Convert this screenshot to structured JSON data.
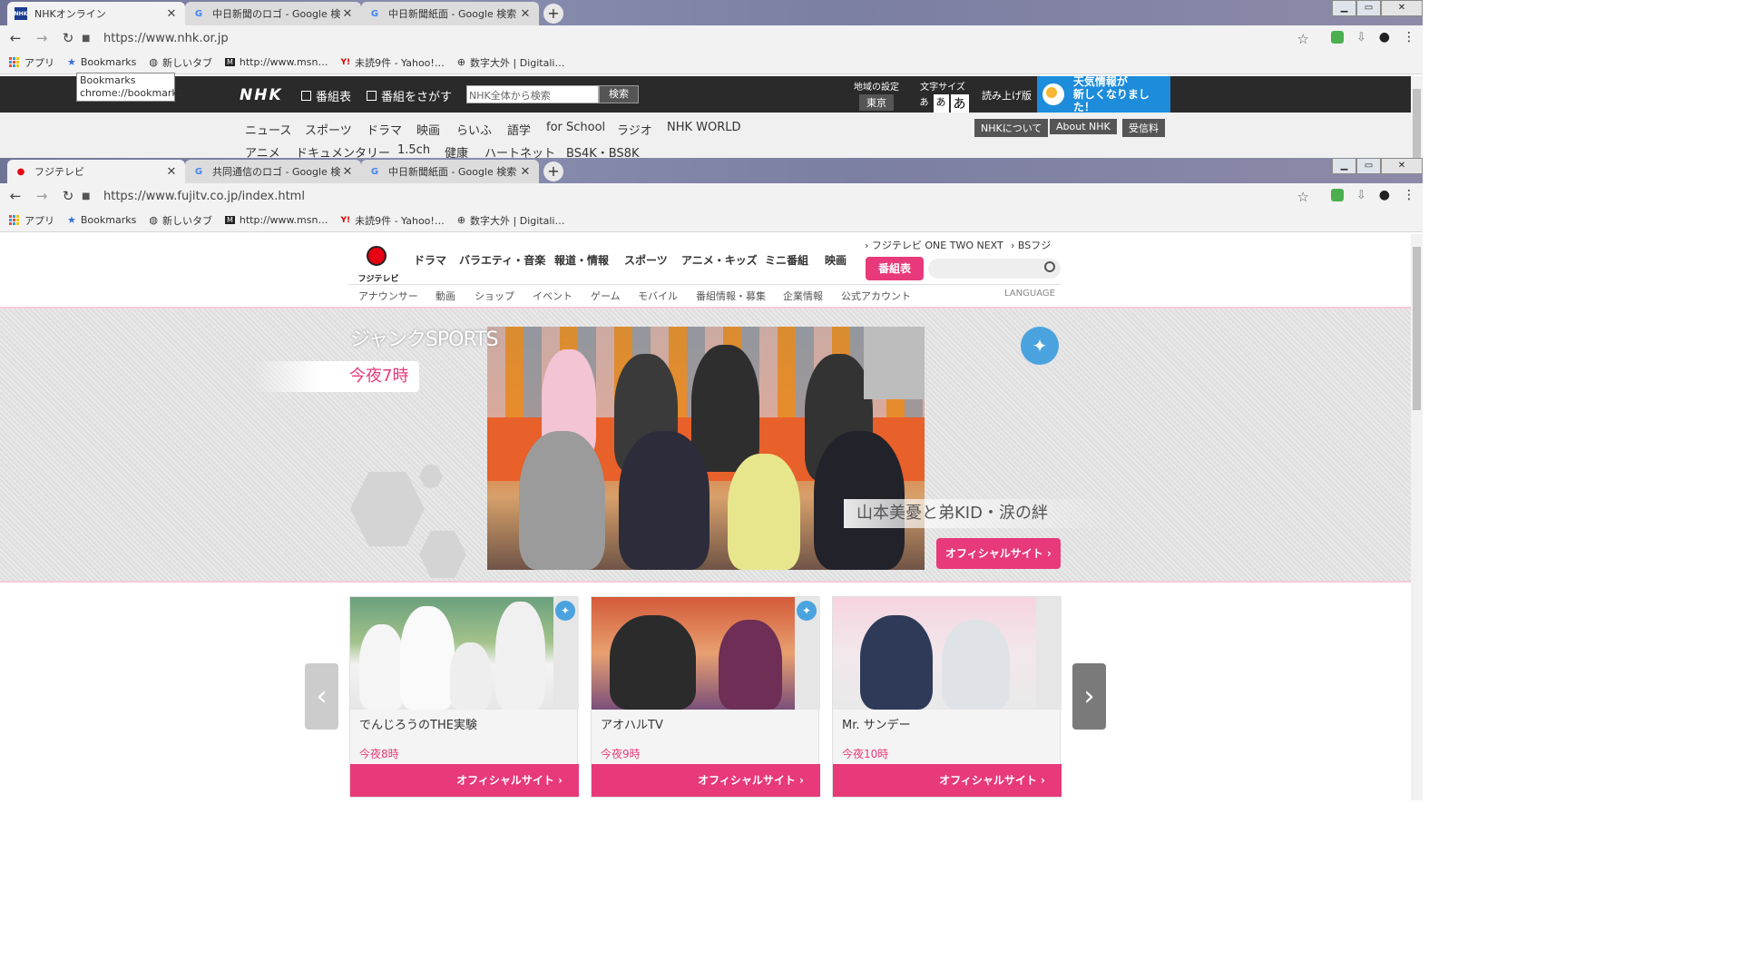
{
  "window1": {
    "tabs": [
      {
        "title": "NHKオンライン",
        "favicon": "nhk-favicon",
        "active": true
      },
      {
        "title": "中日新聞のロゴ - Google 検索",
        "favicon": "google-g",
        "active": false
      },
      {
        "title": "中日新聞紙面 - Google 検索",
        "favicon": "google-g",
        "active": false
      }
    ],
    "url": "https://www.nhk.or.jp",
    "tooltip_line1": "Bookmarks",
    "tooltip_line2": "chrome://bookmarks"
  },
  "window2": {
    "tabs": [
      {
        "title": "フジテレビ",
        "favicon": "fuji-favicon",
        "active": true
      },
      {
        "title": "共同通信のロゴ - Google 検索",
        "favicon": "google-g",
        "active": false
      },
      {
        "title": "中日新聞紙面 - Google 検索",
        "favicon": "google-g",
        "active": false
      }
    ],
    "url": "https://www.fujitv.co.jp/index.html"
  },
  "bookmarks": [
    {
      "label": "アプリ",
      "icon": "apps-grid-icon"
    },
    {
      "label": "Bookmarks",
      "icon": "star-icon"
    },
    {
      "label": "新しいタブ",
      "icon": "globe-icon"
    },
    {
      "label": "http://www.msn…",
      "icon": "msn-icon"
    },
    {
      "label": "未読9件 - Yahoo!…",
      "icon": "yahoo-icon"
    },
    {
      "label": "数字大外 | Digitali…",
      "icon": "site-icon"
    }
  ],
  "nhk": {
    "logo": "NHK",
    "schedule": "番組表",
    "find_programs": "番組をさがす",
    "search_placeholder": "NHK全体から検索",
    "search_button": "検索",
    "region_label": "地域の設定",
    "region_value": "東京",
    "font_size_label": "文字サイズ",
    "font_small": "あ",
    "font_medium": "あ",
    "font_large": "あ",
    "read_aloud": "読み上げ版",
    "weather_line1": "天気情報が",
    "weather_line2": "新しくなりました！",
    "nav_row1": [
      "ニュース",
      "スポーツ",
      "ドラマ",
      "映画",
      "らいふ",
      "語学",
      "for School",
      "ラジオ",
      "NHK WORLD"
    ],
    "nav_row2": [
      "アニメ",
      "ドキュメンタリー",
      "1.5ch",
      "健康",
      "ハートネット",
      "BS4K・BS8K"
    ],
    "tags": [
      "NHKについて",
      "About NHK",
      "受信料"
    ]
  },
  "fuji": {
    "logo_text": "フジテレビ",
    "menu": [
      "ドラマ",
      "バラエティ・音楽",
      "報道・情報",
      "スポーツ",
      "アニメ・キッズ",
      "ミニ番組",
      "映画"
    ],
    "top_links": [
      "フジテレビ ONE TWO NEXT",
      "BSフジ"
    ],
    "schedule_button": "番組表",
    "submenu": [
      "アナウンサー",
      "動画",
      "ショップ",
      "イベント",
      "ゲーム",
      "モバイル",
      "番組情報・募集",
      "企業情報",
      "公式アカウント"
    ],
    "language": "LANGUAGE",
    "hero": {
      "title": "ジャンクSPORTS",
      "time": "今夜7時",
      "caption": "山本美憂と弟KID・涙の絆",
      "official": "オフィシャルサイト"
    },
    "cards": [
      {
        "name": "でんじろうのTHE実験",
        "time": "今夜8時",
        "official": "オフィシャルサイト"
      },
      {
        "name": "アオハルTV",
        "time": "今夜9時",
        "official": "オフィシャルサイト"
      },
      {
        "name": "Mr. サンデー",
        "time": "今夜10時",
        "official": "オフィシャルサイト"
      }
    ]
  },
  "colors": {
    "accent_pink": "#e8397a",
    "nhk_bar": "#2a2a2a",
    "weather_blue": "#1d8cdb",
    "twitter_blue": "#4aa3df"
  }
}
